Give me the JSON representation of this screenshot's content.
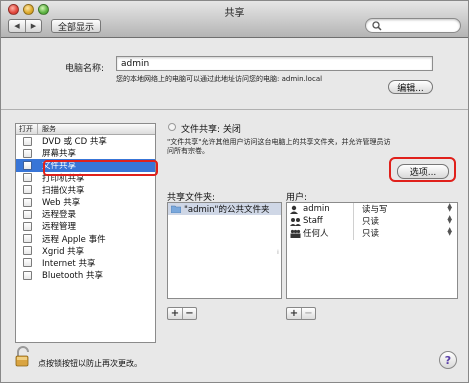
{
  "window": {
    "title": "共享",
    "back_icon": "◀",
    "forward_icon": "▶",
    "show_all_label": "全部显示",
    "search_placeholder": ""
  },
  "computer_name": {
    "label": "电脑名称:",
    "value": "admin",
    "local_note": "您的本地网络上的电脑可以通过此地址访问您的电脑: admin.local",
    "edit_label": "编辑..."
  },
  "services": {
    "header_open": "打开",
    "header_service": "服务",
    "items": [
      {
        "label": "DVD 或 CD 共享",
        "checked": false,
        "selected": false
      },
      {
        "label": "屏幕共享",
        "checked": false,
        "selected": false
      },
      {
        "label": "文件共享",
        "checked": false,
        "selected": true
      },
      {
        "label": "打印机共享",
        "checked": false,
        "selected": false
      },
      {
        "label": "扫描仪共享",
        "checked": false,
        "selected": false
      },
      {
        "label": "Web 共享",
        "checked": false,
        "selected": false
      },
      {
        "label": "远程登录",
        "checked": false,
        "selected": false
      },
      {
        "label": "远程管理",
        "checked": false,
        "selected": false
      },
      {
        "label": "远程 Apple 事件",
        "checked": false,
        "selected": false
      },
      {
        "label": "Xgrid 共享",
        "checked": false,
        "selected": false
      },
      {
        "label": "Internet 共享",
        "checked": false,
        "selected": false
      },
      {
        "label": "Bluetooth 共享",
        "checked": false,
        "selected": false
      }
    ]
  },
  "file_sharing": {
    "status": "文件共享: 关闭",
    "description": "\"文件共享\"允许其他用户访问这台电脑上的共享文件夹，并允许管理员访问所有宗卷。",
    "options_label": "选项...",
    "folders_label": "共享文件夹:",
    "users_label": "用户:",
    "folders": [
      {
        "name": "\"admin\"的公共文件夹"
      }
    ],
    "users": [
      {
        "name": "admin",
        "permission": "读与写",
        "icon": "single-user-icon"
      },
      {
        "name": "Staff",
        "permission": "只读",
        "icon": "group-icon"
      },
      {
        "name": "任何人",
        "permission": "只读",
        "icon": "everyone-icon"
      }
    ],
    "add_label": "+",
    "remove_label": "−"
  },
  "footer": {
    "lock_text": "点按锁按钮以防止再次更改。",
    "help_label": "?"
  },
  "colors": {
    "selection": "#3875d7",
    "highlight_ring": "#e0201b"
  }
}
